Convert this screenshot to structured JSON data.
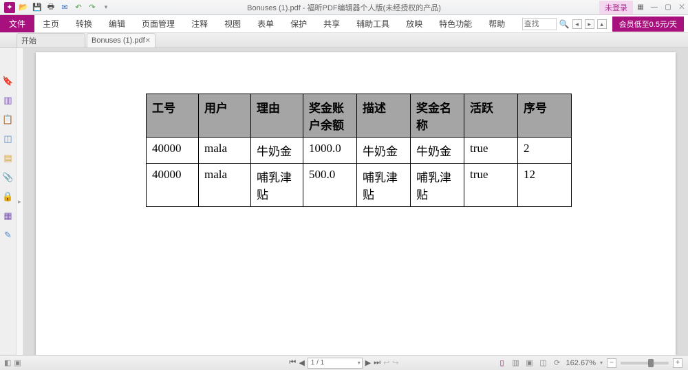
{
  "titlebar": {
    "title": "Bonuses (1).pdf - 福昕PDF编辑器个人版(未经授权的产品)",
    "login": "未登录"
  },
  "menu": {
    "file": "文件",
    "items": [
      "主页",
      "转换",
      "编辑",
      "页面管理",
      "注释",
      "视图",
      "表单",
      "保护",
      "共享",
      "辅助工具",
      "放映",
      "特色功能",
      "帮助"
    ],
    "search": "查找",
    "promo": "会员低至0.5元/天"
  },
  "tabs": {
    "start": "开始",
    "doc": "Bonuses (1).pdf"
  },
  "table": {
    "headers": [
      "工号",
      "用户",
      "理由",
      "奖金账户余额",
      "描述",
      "奖金名称",
      "活跃",
      "序号"
    ],
    "rows": [
      [
        "40000",
        "mala",
        "牛奶金",
        "1000.0",
        "牛奶金",
        "牛奶金",
        "true",
        "2"
      ],
      [
        "40000",
        "mala",
        "哺乳津贴",
        "500.0",
        "哺乳津贴",
        "哺乳津贴",
        "true",
        "12"
      ]
    ]
  },
  "status": {
    "page": "1 / 1",
    "zoom": "162.67%"
  }
}
